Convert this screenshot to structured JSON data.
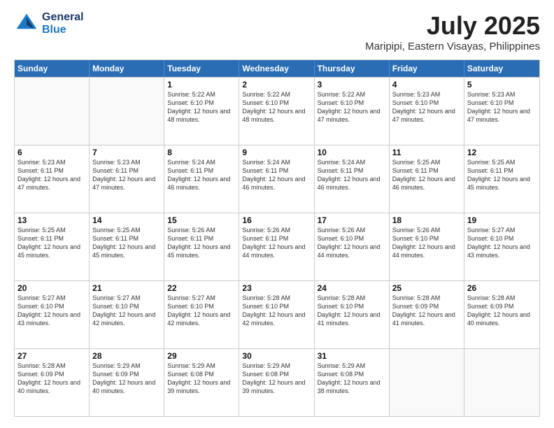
{
  "header": {
    "logo_line1": "General",
    "logo_line2": "Blue",
    "title": "July 2025",
    "subtitle": "Maripipi, Eastern Visayas, Philippines"
  },
  "weekdays": [
    "Sunday",
    "Monday",
    "Tuesday",
    "Wednesday",
    "Thursday",
    "Friday",
    "Saturday"
  ],
  "weeks": [
    [
      {
        "day": "",
        "sunrise": "",
        "sunset": "",
        "daylight": ""
      },
      {
        "day": "",
        "sunrise": "",
        "sunset": "",
        "daylight": ""
      },
      {
        "day": "1",
        "sunrise": "Sunrise: 5:22 AM",
        "sunset": "Sunset: 6:10 PM",
        "daylight": "Daylight: 12 hours and 48 minutes."
      },
      {
        "day": "2",
        "sunrise": "Sunrise: 5:22 AM",
        "sunset": "Sunset: 6:10 PM",
        "daylight": "Daylight: 12 hours and 48 minutes."
      },
      {
        "day": "3",
        "sunrise": "Sunrise: 5:22 AM",
        "sunset": "Sunset: 6:10 PM",
        "daylight": "Daylight: 12 hours and 47 minutes."
      },
      {
        "day": "4",
        "sunrise": "Sunrise: 5:23 AM",
        "sunset": "Sunset: 6:10 PM",
        "daylight": "Daylight: 12 hours and 47 minutes."
      },
      {
        "day": "5",
        "sunrise": "Sunrise: 5:23 AM",
        "sunset": "Sunset: 6:10 PM",
        "daylight": "Daylight: 12 hours and 47 minutes."
      }
    ],
    [
      {
        "day": "6",
        "sunrise": "Sunrise: 5:23 AM",
        "sunset": "Sunset: 6:11 PM",
        "daylight": "Daylight: 12 hours and 47 minutes."
      },
      {
        "day": "7",
        "sunrise": "Sunrise: 5:23 AM",
        "sunset": "Sunset: 6:11 PM",
        "daylight": "Daylight: 12 hours and 47 minutes."
      },
      {
        "day": "8",
        "sunrise": "Sunrise: 5:24 AM",
        "sunset": "Sunset: 6:11 PM",
        "daylight": "Daylight: 12 hours and 46 minutes."
      },
      {
        "day": "9",
        "sunrise": "Sunrise: 5:24 AM",
        "sunset": "Sunset: 6:11 PM",
        "daylight": "Daylight: 12 hours and 46 minutes."
      },
      {
        "day": "10",
        "sunrise": "Sunrise: 5:24 AM",
        "sunset": "Sunset: 6:11 PM",
        "daylight": "Daylight: 12 hours and 46 minutes."
      },
      {
        "day": "11",
        "sunrise": "Sunrise: 5:25 AM",
        "sunset": "Sunset: 6:11 PM",
        "daylight": "Daylight: 12 hours and 46 minutes."
      },
      {
        "day": "12",
        "sunrise": "Sunrise: 5:25 AM",
        "sunset": "Sunset: 6:11 PM",
        "daylight": "Daylight: 12 hours and 45 minutes."
      }
    ],
    [
      {
        "day": "13",
        "sunrise": "Sunrise: 5:25 AM",
        "sunset": "Sunset: 6:11 PM",
        "daylight": "Daylight: 12 hours and 45 minutes."
      },
      {
        "day": "14",
        "sunrise": "Sunrise: 5:25 AM",
        "sunset": "Sunset: 6:11 PM",
        "daylight": "Daylight: 12 hours and 45 minutes."
      },
      {
        "day": "15",
        "sunrise": "Sunrise: 5:26 AM",
        "sunset": "Sunset: 6:11 PM",
        "daylight": "Daylight: 12 hours and 45 minutes."
      },
      {
        "day": "16",
        "sunrise": "Sunrise: 5:26 AM",
        "sunset": "Sunset: 6:11 PM",
        "daylight": "Daylight: 12 hours and 44 minutes."
      },
      {
        "day": "17",
        "sunrise": "Sunrise: 5:26 AM",
        "sunset": "Sunset: 6:10 PM",
        "daylight": "Daylight: 12 hours and 44 minutes."
      },
      {
        "day": "18",
        "sunrise": "Sunrise: 5:26 AM",
        "sunset": "Sunset: 6:10 PM",
        "daylight": "Daylight: 12 hours and 44 minutes."
      },
      {
        "day": "19",
        "sunrise": "Sunrise: 5:27 AM",
        "sunset": "Sunset: 6:10 PM",
        "daylight": "Daylight: 12 hours and 43 minutes."
      }
    ],
    [
      {
        "day": "20",
        "sunrise": "Sunrise: 5:27 AM",
        "sunset": "Sunset: 6:10 PM",
        "daylight": "Daylight: 12 hours and 43 minutes."
      },
      {
        "day": "21",
        "sunrise": "Sunrise: 5:27 AM",
        "sunset": "Sunset: 6:10 PM",
        "daylight": "Daylight: 12 hours and 42 minutes."
      },
      {
        "day": "22",
        "sunrise": "Sunrise: 5:27 AM",
        "sunset": "Sunset: 6:10 PM",
        "daylight": "Daylight: 12 hours and 42 minutes."
      },
      {
        "day": "23",
        "sunrise": "Sunrise: 5:28 AM",
        "sunset": "Sunset: 6:10 PM",
        "daylight": "Daylight: 12 hours and 42 minutes."
      },
      {
        "day": "24",
        "sunrise": "Sunrise: 5:28 AM",
        "sunset": "Sunset: 6:10 PM",
        "daylight": "Daylight: 12 hours and 41 minutes."
      },
      {
        "day": "25",
        "sunrise": "Sunrise: 5:28 AM",
        "sunset": "Sunset: 6:09 PM",
        "daylight": "Daylight: 12 hours and 41 minutes."
      },
      {
        "day": "26",
        "sunrise": "Sunrise: 5:28 AM",
        "sunset": "Sunset: 6:09 PM",
        "daylight": "Daylight: 12 hours and 40 minutes."
      }
    ],
    [
      {
        "day": "27",
        "sunrise": "Sunrise: 5:28 AM",
        "sunset": "Sunset: 6:09 PM",
        "daylight": "Daylight: 12 hours and 40 minutes."
      },
      {
        "day": "28",
        "sunrise": "Sunrise: 5:29 AM",
        "sunset": "Sunset: 6:09 PM",
        "daylight": "Daylight: 12 hours and 40 minutes."
      },
      {
        "day": "29",
        "sunrise": "Sunrise: 5:29 AM",
        "sunset": "Sunset: 6:08 PM",
        "daylight": "Daylight: 12 hours and 39 minutes."
      },
      {
        "day": "30",
        "sunrise": "Sunrise: 5:29 AM",
        "sunset": "Sunset: 6:08 PM",
        "daylight": "Daylight: 12 hours and 39 minutes."
      },
      {
        "day": "31",
        "sunrise": "Sunrise: 5:29 AM",
        "sunset": "Sunset: 6:08 PM",
        "daylight": "Daylight: 12 hours and 38 minutes."
      },
      {
        "day": "",
        "sunrise": "",
        "sunset": "",
        "daylight": ""
      },
      {
        "day": "",
        "sunrise": "",
        "sunset": "",
        "daylight": ""
      }
    ]
  ]
}
